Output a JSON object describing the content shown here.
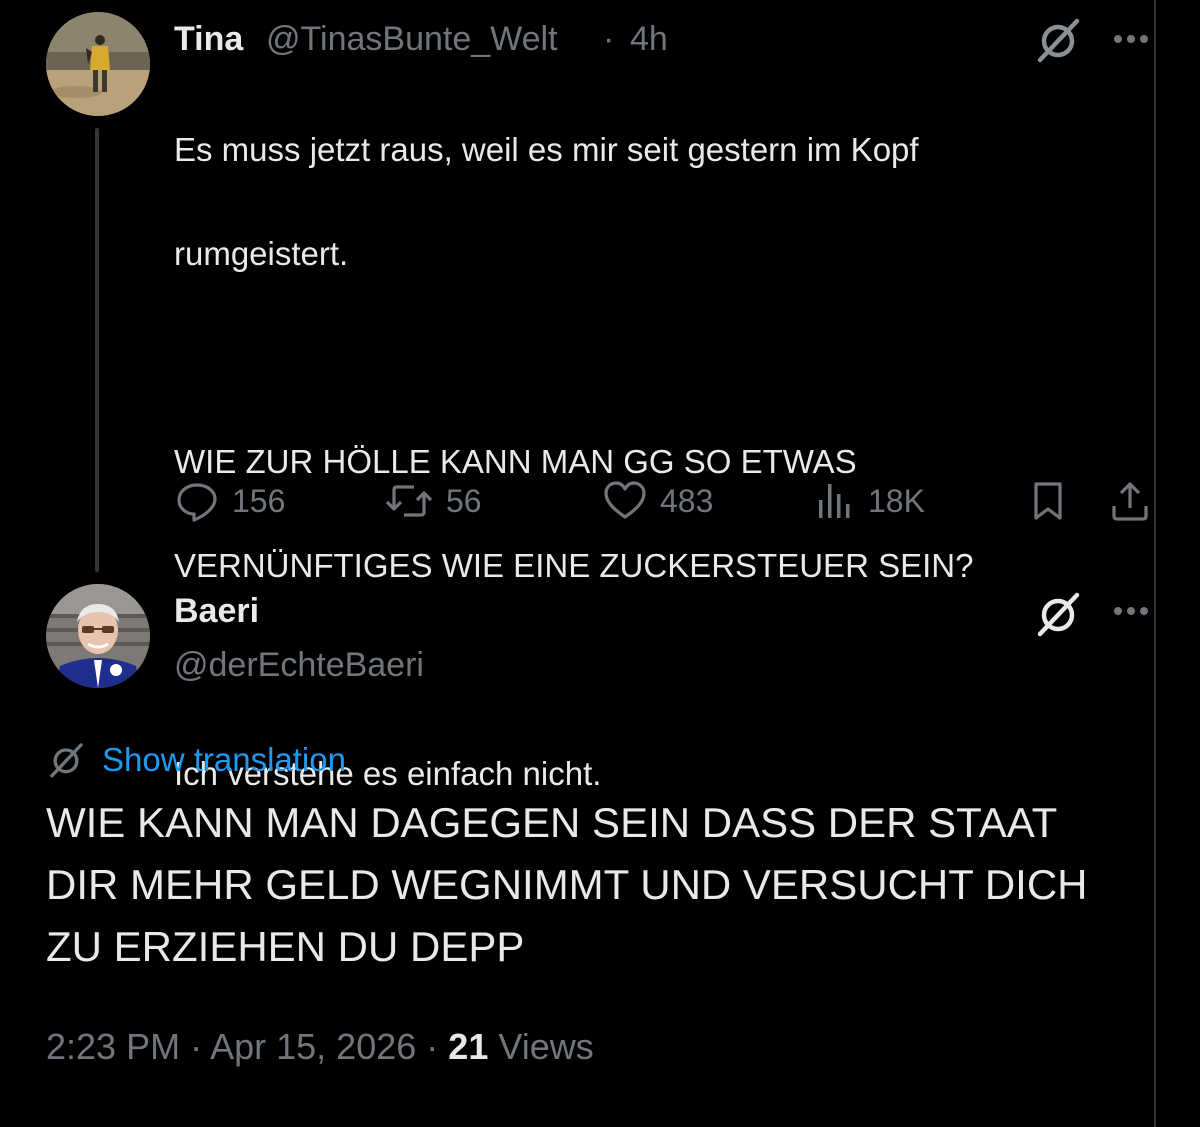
{
  "original_post": {
    "name": "Tina",
    "handle": "@TinasBunte_Welt",
    "separator": "·",
    "time": "4h",
    "text_lines": [
      "Es muss jetzt raus, weil es mir seit gestern im Kopf",
      "rumgeistert.",
      "",
      "WIE ZUR HÖLLE KANN MAN GG SO ETWAS",
      "VERNÜNFTIGES WIE EINE ZUCKERSTEUER SEIN?",
      "",
      "Ich verstehe es einfach nicht."
    ],
    "actions": {
      "replies": "156",
      "reposts": "56",
      "likes": "483",
      "views": "18K"
    },
    "more_icon": "more-dots-icon",
    "grok_icon": "grok-icon"
  },
  "reply_post": {
    "name": "Baeri",
    "handle": "@derEchteBaeri",
    "translation_label": "Show translation",
    "text_lines": [
      "WIE KANN MAN DAGEGEN SEIN DASS DER STAAT",
      "DIR MEHR GELD WEGNIMMT UND VERSUCHT DICH",
      "ZU ERZIEHEN DU DEPP"
    ],
    "time": "2:23 PM",
    "date": "Apr 15, 2026",
    "views_count": "21",
    "views_label": "Views",
    "separator": "·"
  },
  "colors": {
    "background": "#000000",
    "text_primary": "#e7e9ea",
    "text_secondary": "#71767b",
    "link": "#1d9bf0"
  }
}
